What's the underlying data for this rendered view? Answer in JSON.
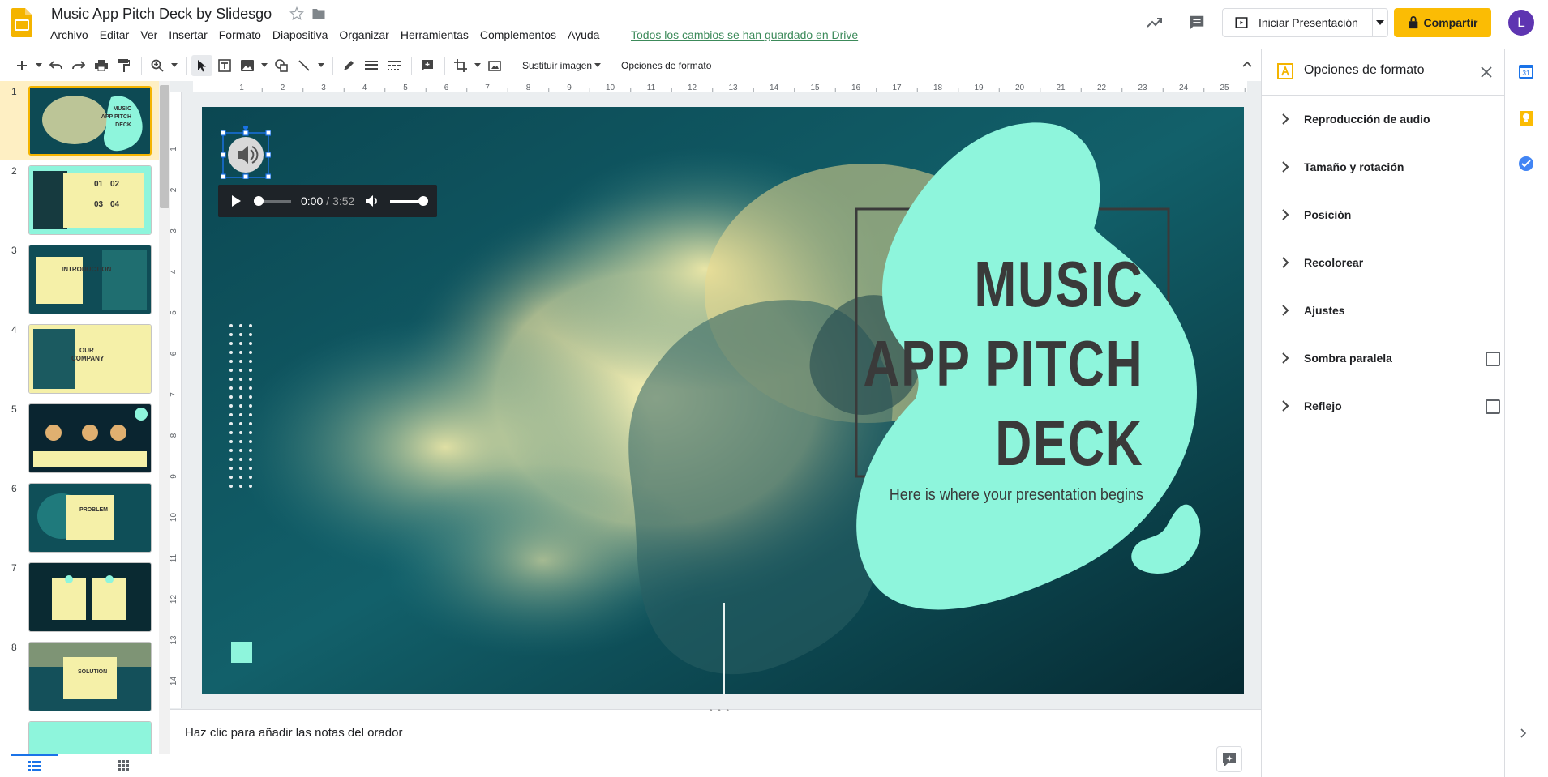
{
  "app": {
    "title": "Music App Pitch Deck by Slidesgo",
    "save_status": "Todos los cambios se han guardado en Drive",
    "avatar_letter": "L"
  },
  "menu": [
    "Archivo",
    "Editar",
    "Ver",
    "Insertar",
    "Formato",
    "Diapositiva",
    "Organizar",
    "Herramientas",
    "Complementos",
    "Ayuda"
  ],
  "header_buttons": {
    "present_label": "Iniciar Presentación",
    "share_label": "Compartir"
  },
  "toolbar": {
    "replace_image_label": "Sustituir imagen",
    "format_options_label": "Opciones de formato"
  },
  "filmstrip": {
    "slides": [
      {
        "num": "1",
        "label": "MUSIC APP PITCH DECK",
        "active": true
      },
      {
        "num": "2",
        "label": "01 02 03 04"
      },
      {
        "num": "3",
        "label": "INTRODUCTION"
      },
      {
        "num": "4",
        "label": "OUR COMPANY"
      },
      {
        "num": "5",
        "label": ""
      },
      {
        "num": "6",
        "label": "PROBLEM"
      },
      {
        "num": "7",
        "label": ""
      },
      {
        "num": "8",
        "label": "SOLUTION"
      }
    ]
  },
  "slide": {
    "title_lines": [
      "MUSIC",
      "APP PITCH",
      "DECK"
    ],
    "subtitle": "Here is where your presentation begins",
    "audio": {
      "current_time": "0:00",
      "duration": "/ 3:52",
      "progress": 0.0,
      "volume": 0.85
    }
  },
  "ruler": {
    "h_ticks": [
      "1",
      "2",
      "3",
      "4",
      "5",
      "6",
      "7",
      "8",
      "9",
      "10",
      "11",
      "12",
      "13",
      "14",
      "15",
      "16",
      "17",
      "18",
      "19",
      "20",
      "21",
      "22",
      "23",
      "24",
      "25"
    ],
    "v_ticks": [
      "1",
      "2",
      "3",
      "4",
      "5",
      "6",
      "7",
      "8",
      "9",
      "10",
      "11",
      "12",
      "13",
      "14"
    ]
  },
  "notes": {
    "placeholder": "Haz clic para añadir las notas del orador"
  },
  "format_panel": {
    "title": "Opciones de formato",
    "items": [
      {
        "label": "Reproducción de audio",
        "checkbox": false
      },
      {
        "label": "Tamaño y rotación",
        "checkbox": false
      },
      {
        "label": "Posición",
        "checkbox": false
      },
      {
        "label": "Recolorear",
        "checkbox": false
      },
      {
        "label": "Ajustes",
        "checkbox": false
      },
      {
        "label": "Sombra paralela",
        "checkbox": true,
        "checked": false
      },
      {
        "label": "Reflejo",
        "checkbox": true,
        "checked": false
      }
    ]
  },
  "colors": {
    "accent": "#fbbc04",
    "mint": "#8ef5dc",
    "teal_dark": "#0a3a44",
    "smoke": "#f3eeb0",
    "selection_blue": "#1a73e8"
  }
}
